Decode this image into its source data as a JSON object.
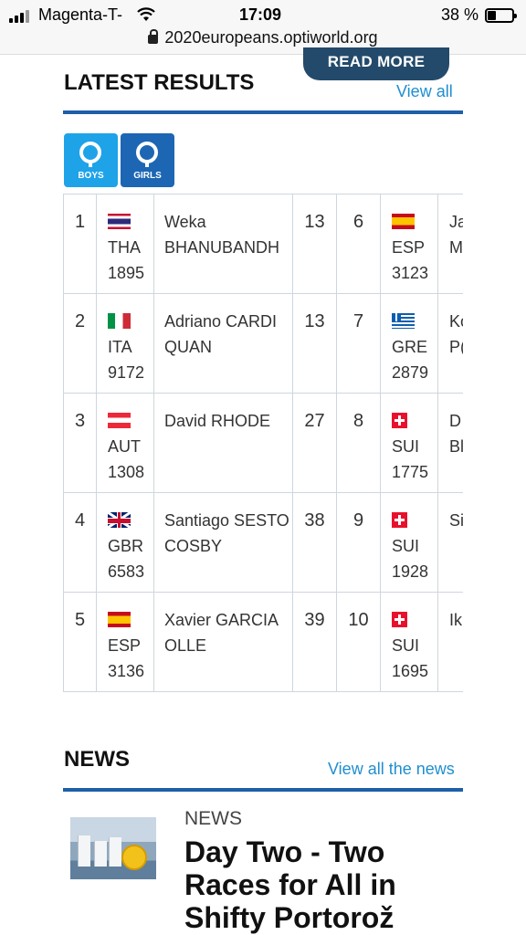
{
  "status_bar": {
    "carrier": "Magenta-T-",
    "time": "17:09",
    "battery": "38 %",
    "url": "2020europeans.optiworld.org"
  },
  "read_more": "READ MORE",
  "latest_results": {
    "title": "LATEST RESULTS",
    "view_all": "View all",
    "tabs": [
      {
        "label": "BOYS",
        "icon": "optimist-logo-icon",
        "color": "#1ea3e8"
      },
      {
        "label": "GIRLS",
        "icon": "optimist-logo-icon",
        "color": "#1d66b4"
      }
    ],
    "rows": [
      {
        "rank": "1",
        "nat": "THA",
        "sail": "1895",
        "name1": "Weka",
        "name2": "BHANUBANDH",
        "pts": "13",
        "rank_b": "6",
        "nat_b": "ESP",
        "sail_b": "3123",
        "name_b1": "Ja",
        "name_b2": "M"
      },
      {
        "rank": "2",
        "nat": "ITA",
        "sail": "9172",
        "name1": "Adriano CARDI",
        "name2": "QUAN",
        "pts": "13",
        "rank_b": "7",
        "nat_b": "GRE",
        "sail_b": "2879",
        "name_b1": "Ko",
        "name_b2": "P("
      },
      {
        "rank": "3",
        "nat": "AUT",
        "sail": "1308",
        "name1": "David RHODE",
        "name2": "",
        "pts": "27",
        "rank_b": "8",
        "nat_b": "SUI",
        "sail_b": "1775",
        "name_b1": "D",
        "name_b2": "Bl"
      },
      {
        "rank": "4",
        "nat": "GBR",
        "sail": "6583",
        "name1": "Santiago SESTO",
        "name2": "COSBY",
        "pts": "38",
        "rank_b": "9",
        "nat_b": "SUI",
        "sail_b": "1928",
        "name_b1": "Si",
        "name_b2": ""
      },
      {
        "rank": "5",
        "nat": "ESP",
        "sail": "3136",
        "name1": "Xavier GARCIA",
        "name2": "OLLE",
        "pts": "39",
        "rank_b": "10",
        "nat_b": "SUI",
        "sail_b": "1695",
        "name_b1": "Ik",
        "name_b2": ""
      }
    ]
  },
  "news": {
    "title": "NEWS",
    "view_all": "View all the news",
    "item": {
      "category": "NEWS",
      "headline": "Day Two - Two Races for All in Shifty Portorož"
    }
  },
  "colors": {
    "accent": "#1d5fa8",
    "link": "#1f8ecf",
    "button": "#234a6b"
  }
}
